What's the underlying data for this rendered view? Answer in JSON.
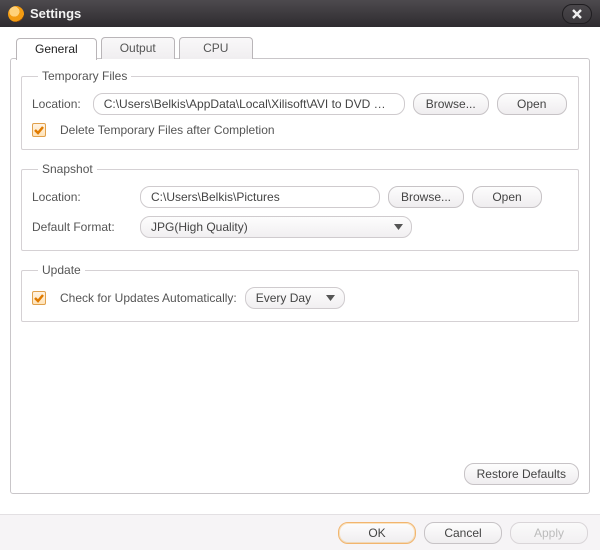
{
  "window": {
    "title": "Settings"
  },
  "tabs": {
    "general": "General",
    "output": "Output",
    "cpu": "CPU"
  },
  "groups": {
    "temp": {
      "legend": "Temporary Files",
      "location_label": "Location:",
      "location_value": "C:\\Users\\Belkis\\AppData\\Local\\Xilisoft\\AVI to DVD Conv",
      "browse": "Browse...",
      "open": "Open",
      "delete_after": "Delete Temporary Files after Completion"
    },
    "snapshot": {
      "legend": "Snapshot",
      "location_label": "Location:",
      "location_value": "C:\\Users\\Belkis\\Pictures",
      "browse": "Browse...",
      "open": "Open",
      "format_label": "Default Format:",
      "format_value": "JPG(High Quality)"
    },
    "update": {
      "legend": "Update",
      "check_label": "Check for Updates Automatically:",
      "frequency": "Every Day"
    }
  },
  "buttons": {
    "restore_defaults": "Restore Defaults",
    "ok": "OK",
    "cancel": "Cancel",
    "apply": "Apply"
  }
}
